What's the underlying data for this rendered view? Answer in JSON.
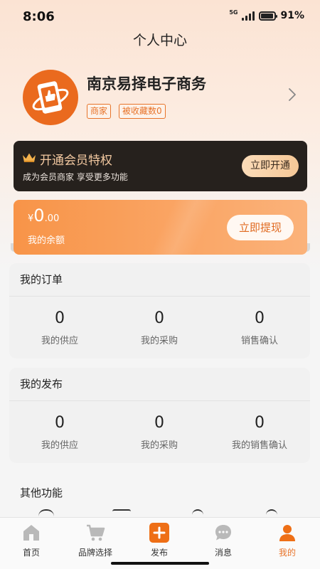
{
  "status_bar": {
    "time": "8:06",
    "network": "5G",
    "battery": "91%",
    "battery_level": 0.91
  },
  "header": {
    "title": "个人中心"
  },
  "profile": {
    "company_name": "南京易择电子商务",
    "tags": [
      "商家",
      "被收藏数0"
    ],
    "avatar_icon": "shop-thumbs-up-icon"
  },
  "vip": {
    "title": "开通会员特权",
    "subtitle": "成为会员商家 享受更多功能",
    "button": "立即开通",
    "icon": "crown-icon"
  },
  "balance": {
    "currency": "¥",
    "amount_int": "0",
    "amount_dec": ".00",
    "label": "我的余额",
    "button": "立即提现"
  },
  "orders": {
    "title": "我的订单",
    "stats": [
      {
        "value": "0",
        "label": "我的供应"
      },
      {
        "value": "0",
        "label": "我的采购"
      },
      {
        "value": "0",
        "label": "销售确认"
      }
    ]
  },
  "publish": {
    "title": "我的发布",
    "stats": [
      {
        "value": "0",
        "label": "我的供应"
      },
      {
        "value": "0",
        "label": "我的采购"
      },
      {
        "value": "0",
        "label": "我的销售确认"
      }
    ]
  },
  "other": {
    "title": "其他功能"
  },
  "tab_bar": {
    "items": [
      {
        "label": "首页",
        "icon": "home-icon"
      },
      {
        "label": "品牌选择",
        "icon": "cart-icon"
      },
      {
        "label": "发布",
        "icon": "plus-icon"
      },
      {
        "label": "消息",
        "icon": "message-icon"
      },
      {
        "label": "我的",
        "icon": "user-icon"
      }
    ],
    "active": "我的"
  },
  "colors": {
    "accent": "#e8742a",
    "vip_bg": "#26211d",
    "balance_start": "#f89448",
    "balance_end": "#fbb27a"
  }
}
